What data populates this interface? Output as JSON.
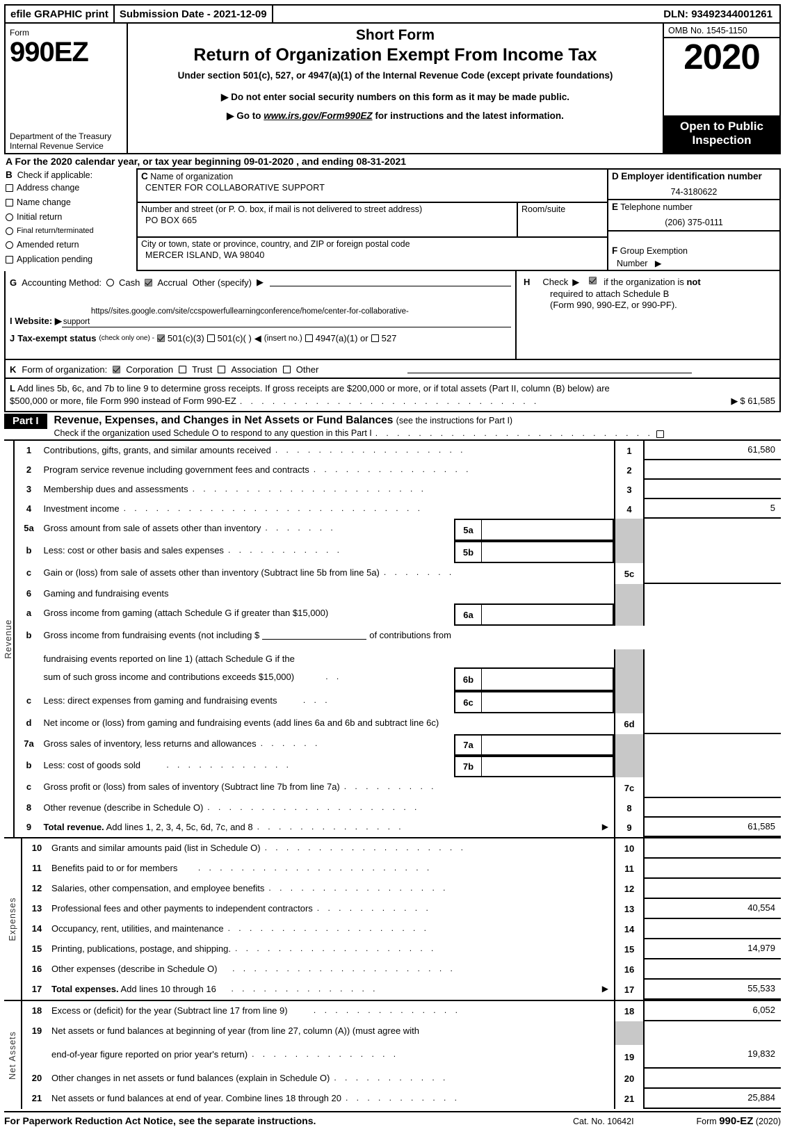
{
  "efile": {
    "graphic_print": "efile GRAPHIC print",
    "submission_date": "Submission Date - 2021-12-09",
    "dln": "DLN: 93492344001261"
  },
  "masthead": {
    "form_label": "Form",
    "form_number": "990EZ",
    "department": "Department of the Treasury Internal Revenue Service",
    "short_form": "Short Form",
    "title": "Return of Organization Exempt From Income Tax",
    "under_section": "Under section 501(c), 527, or 4947(a)(1) of the Internal Revenue Code (except private foundations)",
    "bullet1": "Do not enter social security numbers on this form as it may be made public.",
    "bullet2_pre": "Go to ",
    "bullet2_url": "www.irs.gov/Form990EZ",
    "bullet2_post": " for instructions and the latest information.",
    "omb": "OMB No. 1545-1150",
    "year": "2020",
    "open_to_public": "Open to Public Inspection"
  },
  "line_a": {
    "letter": "A",
    "text": "For the 2020 calendar year, or tax year beginning 09-01-2020 , and ending 08-31-2021"
  },
  "section_b": {
    "letter": "B",
    "heading": "Check if applicable:",
    "items": [
      {
        "label": "Address change",
        "checked": false,
        "shape": "square"
      },
      {
        "label": "Name change",
        "checked": false,
        "shape": "square"
      },
      {
        "label": "Initial return",
        "checked": false,
        "shape": "round"
      },
      {
        "label": "Final return/terminated",
        "checked": false,
        "shape": "round"
      },
      {
        "label": "Amended return",
        "checked": false,
        "shape": "round"
      },
      {
        "label": "Application pending",
        "checked": false,
        "shape": "square"
      }
    ]
  },
  "section_c": {
    "letter": "C",
    "name_label": "Name of organization",
    "name_value": "CENTER FOR COLLABORATIVE SUPPORT",
    "street_label": "Number and street (or P. O. box, if mail is not delivered to street address)",
    "street_value": "PO BOX 665",
    "room_label": "Room/suite",
    "room_value": "",
    "city_label": "City or town, state or province, country, and ZIP or foreign postal code",
    "city_value": "MERCER ISLAND, WA  98040"
  },
  "section_d": {
    "letter": "D",
    "label": "Employer identification number",
    "value": "74-3180622"
  },
  "section_e": {
    "letter": "E",
    "label": "Telephone number",
    "value": "(206) 375-0111"
  },
  "section_f": {
    "letter": "F",
    "label": "Group Exemption",
    "label2": "Number",
    "value": ""
  },
  "section_g": {
    "letter": "G",
    "label": "Accounting Method:",
    "cash_label": "Cash",
    "cash_checked": false,
    "accrual_label": "Accrual",
    "accrual_checked": true,
    "other_label": "Other (specify)",
    "other_value": ""
  },
  "section_h": {
    "letter": "H",
    "pre": "Check",
    "checked": true,
    "text1_a": "if the organization is ",
    "text1_b": "not",
    "text2": "required to attach Schedule B",
    "text3": "(Form 990, 990-EZ, or 990-PF)."
  },
  "section_i": {
    "letter": "I",
    "label": "Website:",
    "url_line1": "https//sites.google.com/site/ccspowerfullearningconference/home/center-for-collaborative-",
    "url_line2": "support"
  },
  "section_j": {
    "letter": "J",
    "label": "Tax-exempt status",
    "note": "(check only one) -",
    "options": [
      {
        "label": "501(c)(3)",
        "checked": true
      },
      {
        "label": "501(c)(   )",
        "checked": false
      },
      {
        "label": "4947(a)(1) or",
        "checked": false
      },
      {
        "label": "527",
        "checked": false
      }
    ],
    "insert_no": "(insert no.)"
  },
  "section_k": {
    "letter": "K",
    "label": "Form of organization:",
    "options": [
      {
        "label": "Corporation",
        "checked": true
      },
      {
        "label": "Trust",
        "checked": false
      },
      {
        "label": "Association",
        "checked": false
      },
      {
        "label": "Other",
        "checked": false
      }
    ]
  },
  "section_l": {
    "letter": "L",
    "text_line1": "Add lines 5b, 6c, and 7b to line 9 to determine gross receipts. If gross receipts are $200,000 or more, or if total assets (Part II, column (B) below) are",
    "text_line2": "$500,000 or more, file Form 990 instead of Form 990-EZ",
    "amount": "$ 61,585"
  },
  "part1": {
    "tag": "Part I",
    "title": "Revenue, Expenses, and Changes in Net Assets or Fund Balances",
    "title_note": "(see the instructions for Part I)",
    "subtext": "Check if the organization used Schedule O to respond to any question in this Part I",
    "checked": false
  },
  "sections": [
    {
      "vlabel": "Revenue",
      "rows": [
        {
          "no": "1",
          "desc": "Contributions, gifts, grants, and similar amounts received",
          "leader": true,
          "rn": "1",
          "value": "61,580"
        },
        {
          "no": "2",
          "desc": "Program service revenue including government fees and contracts",
          "leader": true,
          "rn": "2",
          "value": ""
        },
        {
          "no": "3",
          "desc": "Membership dues and assessments",
          "leader": true,
          "rn": "3",
          "value": ""
        },
        {
          "no": "4",
          "desc": "Investment income",
          "leader": true,
          "rn": "4",
          "value": "5"
        },
        {
          "no": "5a",
          "desc": "Gross amount from sale of assets other than inventory",
          "leader": true,
          "inbox": "5a",
          "rn": "",
          "shade": true,
          "value": ""
        },
        {
          "no": "b",
          "desc": "Less: cost or other basis and sales expenses",
          "leader": true,
          "inbox": "5b",
          "rn": "",
          "shade": true,
          "value": ""
        },
        {
          "no": "c",
          "desc": "Gain or (loss) from sale of assets other than inventory (Subtract line 5b from line 5a)",
          "leader": true,
          "rn": "5c",
          "value": ""
        },
        {
          "no": "6",
          "desc": "Gaming and fundraising events",
          "leader": false,
          "rn": "",
          "shade": true,
          "value": ""
        },
        {
          "no": "a",
          "desc": "Gross income from gaming (attach Schedule G if greater than $15,000)",
          "leader": false,
          "inbox": "6a",
          "rn": "",
          "shade": true,
          "value": ""
        },
        {
          "no": "b",
          "desc": "Gross income from fundraising events (not including $ ________ of contributions from",
          "desc2": "fundraising events reported on line 1) (attach Schedule G if the",
          "desc3": "sum of such gross income and contributions exceeds $15,000)",
          "leader": false,
          "inbox": "6b",
          "rn": "",
          "shade": true,
          "value": ""
        },
        {
          "no": "c",
          "desc": "Less: direct expenses from gaming and fundraising events",
          "leader": true,
          "inbox": "6c",
          "rn": "",
          "shade": true,
          "value": ""
        },
        {
          "no": "d",
          "desc": "Net income or (loss) from gaming and fundraising events (add lines 6a and 6b and subtract line 6c)",
          "leader": false,
          "rn": "6d",
          "value": ""
        },
        {
          "no": "7a",
          "desc": "Gross sales of inventory, less returns and allowances",
          "leader": true,
          "inbox": "7a",
          "rn": "",
          "shade": true,
          "value": ""
        },
        {
          "no": "b",
          "desc": "Less: cost of goods sold",
          "leader": true,
          "inbox": "7b",
          "rn": "",
          "shade": true,
          "value": ""
        },
        {
          "no": "c",
          "desc": "Gross profit or (loss) from sales of inventory (Subtract line 7b from line 7a)",
          "leader": true,
          "rn": "7c",
          "value": ""
        },
        {
          "no": "8",
          "desc": "Other revenue (describe in Schedule O)",
          "leader": true,
          "rn": "8",
          "value": ""
        },
        {
          "no": "9",
          "desc_bold": "Total revenue.",
          "desc": " Add lines 1, 2, 3, 4, 5c, 6d, 7c, and 8",
          "leader": true,
          "arrow": true,
          "rn": "9",
          "value": "61,585"
        }
      ]
    },
    {
      "vlabel": "Expenses",
      "rows": [
        {
          "no": "10",
          "desc": "Grants and similar amounts paid (list in Schedule O)",
          "leader": true,
          "rn": "10",
          "value": ""
        },
        {
          "no": "11",
          "desc": "Benefits paid to or for members",
          "leader": true,
          "rn": "11",
          "value": ""
        },
        {
          "no": "12",
          "desc": "Salaries, other compensation, and employee benefits",
          "leader": true,
          "rn": "12",
          "value": ""
        },
        {
          "no": "13",
          "desc": "Professional fees and other payments to independent contractors",
          "leader": true,
          "rn": "13",
          "value": "40,554"
        },
        {
          "no": "14",
          "desc": "Occupancy, rent, utilities, and maintenance",
          "leader": true,
          "rn": "14",
          "value": ""
        },
        {
          "no": "15",
          "desc": "Printing, publications, postage, and shipping.",
          "leader": true,
          "rn": "15",
          "value": "14,979"
        },
        {
          "no": "16",
          "desc": "Other expenses (describe in Schedule O)",
          "leader": true,
          "rn": "16",
          "value": ""
        },
        {
          "no": "17",
          "desc_bold": "Total expenses.",
          "desc": " Add lines 10 through 16",
          "leader": true,
          "arrow": true,
          "rn": "17",
          "value": "55,533"
        }
      ]
    },
    {
      "vlabel": "Net Assets",
      "rows": [
        {
          "no": "18",
          "desc": "Excess or (deficit) for the year (Subtract line 17 from line 9)",
          "leader": true,
          "rn": "18",
          "value": "6,052"
        },
        {
          "no": "19",
          "desc": "Net assets or fund balances at beginning of year (from line 27, column (A)) (must agree with",
          "leader": false,
          "rn": "",
          "shade": true,
          "value": ""
        },
        {
          "no": "",
          "desc": "end-of-year figure reported on prior year's return)",
          "leader": true,
          "rn": "19",
          "value": "19,832"
        },
        {
          "no": "20",
          "desc": "Other changes in net assets or fund balances (explain in Schedule O)",
          "leader": true,
          "rn": "20",
          "value": ""
        },
        {
          "no": "21",
          "desc": "Net assets or fund balances at end of year. Combine lines 18 through 20",
          "leader": true,
          "rn": "21",
          "value": "25,884"
        }
      ]
    }
  ],
  "footer": {
    "notice": "For Paperwork Reduction Act Notice, see the separate instructions.",
    "cat_no": "Cat. No. 10642I",
    "form_pre": "Form ",
    "form_name": "990-EZ",
    "form_year": " (2020)"
  }
}
